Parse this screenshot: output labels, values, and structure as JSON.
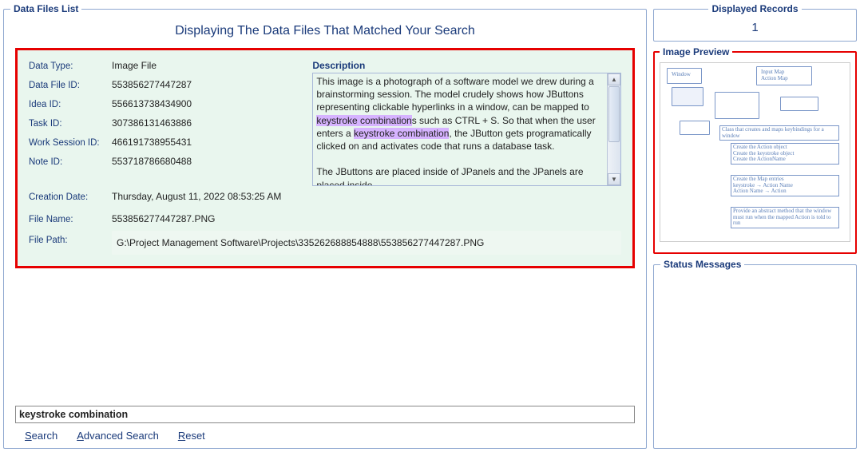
{
  "displayedRecords": {
    "legend": "Displayed Records",
    "count": "1"
  },
  "imagePreview": {
    "legend": "Image Preview"
  },
  "statusMessages": {
    "legend": "Status Messages"
  },
  "list": {
    "legend": "Data Files List",
    "title": "Displaying The Data Files That Matched Your Search"
  },
  "result": {
    "labels": {
      "dataType": "Data Type:",
      "dataFileId": "Data File ID:",
      "ideaId": "Idea ID:",
      "taskId": "Task ID:",
      "workSessionId": "Work Session ID:",
      "noteId": "Note ID:",
      "creationDate": "Creation Date:",
      "fileName": "File Name:",
      "filePath": "File Path:",
      "description": "Description"
    },
    "values": {
      "dataType": "Image File",
      "dataFileId": "553856277447287",
      "ideaId": "556613738434900",
      "taskId": "307386131463886",
      "workSessionId": "466191738955431",
      "noteId": "553718786680488",
      "creationDate": "Thursday, August 11, 2022   08:53:25 AM",
      "fileName": "553856277447287.PNG",
      "filePath": "G:\\Project Management Software\\Projects\\335262688854888\\553856277447287.PNG"
    },
    "description": {
      "p1a": "This image is a photograph of a software model we drew during a brainstorming session. The model crudely shows how JButtons representing clickable hyperlinks in a window, can be mapped to ",
      "hl1": "keystroke combination",
      "p1b": "s such as CTRL + S. So that when the user enters a ",
      "hl2": "keystroke combination",
      "p1c": ", the JButton gets programatically clicked on and activates code that runs a database task.",
      "p2": "The JButtons are placed inside of JPanels and the JPanels are placed inside"
    }
  },
  "search": {
    "value": "keystroke combination",
    "links": {
      "search": {
        "u": "S",
        "rest": "earch"
      },
      "advanced": {
        "u": "A",
        "rest": "dvanced Search"
      },
      "reset": {
        "u": "R",
        "rest": "eset"
      }
    }
  }
}
